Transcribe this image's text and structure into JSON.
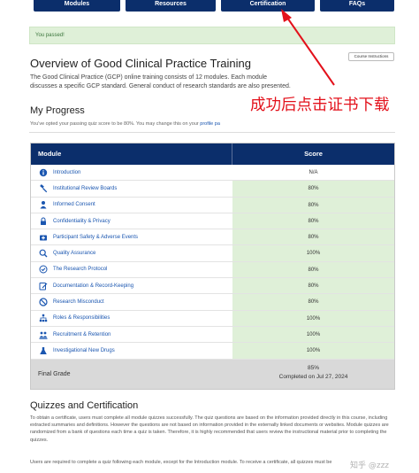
{
  "nav": {
    "tabs": [
      {
        "label": "Modules"
      },
      {
        "label": "Resources"
      },
      {
        "label": "Certification"
      },
      {
        "label": "FAQs"
      }
    ]
  },
  "alert": {
    "text": "You passed!"
  },
  "header": {
    "title": "Overview of Good Clinical Practice Training",
    "course_instructions_button": "Course Instructions",
    "intro": "The Good Clinical Practice (GCP) online training consists of 12 modules. Each module discusses a specific GCP standard. General conduct of research standards are also presented."
  },
  "progress": {
    "title": "My Progress",
    "passing_text": "You've opted your passing quiz score to be 80%. You may change this on your",
    "passing_link": "profile pa"
  },
  "table": {
    "headers": {
      "module": "Module",
      "score": "Score"
    },
    "rows": [
      {
        "icon": "info-icon",
        "module": "Introduction",
        "score": "N/A"
      },
      {
        "icon": "gavel-icon",
        "module": "Institutional Review Boards",
        "score": "80%"
      },
      {
        "icon": "person-icon",
        "module": "Informed Consent",
        "score": "80%"
      },
      {
        "icon": "lock-icon",
        "module": "Confidentiality & Privacy",
        "score": "80%"
      },
      {
        "icon": "first-aid-kit-icon",
        "module": "Participant Safety & Adverse Events",
        "score": "80%"
      },
      {
        "icon": "magnifier-icon",
        "module": "Quality Assurance",
        "score": "100%"
      },
      {
        "icon": "checkmark-circle-icon",
        "module": "The Research Protocol",
        "score": "80%"
      },
      {
        "icon": "edit-document-icon",
        "module": "Documentation & Record-Keeping",
        "score": "80%"
      },
      {
        "icon": "prohibited-icon",
        "module": "Research Misconduct",
        "score": "80%"
      },
      {
        "icon": "sitemap-icon",
        "module": "Roles & Responsibilities",
        "score": "100%"
      },
      {
        "icon": "people-group-icon",
        "module": "Recruitment & Retention",
        "score": "100%"
      },
      {
        "icon": "flask-icon",
        "module": "Investigational New Drugs",
        "score": "100%"
      }
    ],
    "final": {
      "label": "Final Grade",
      "score": "85%",
      "completed": "Completed on Jul 27, 2024"
    }
  },
  "quizzes": {
    "title": "Quizzes and Certification",
    "para1": "To obtain a certificate, users must complete all module quizzes successfully. The quiz questions are based on the information provided directly in this course, including extracted summaries and definitions. However the questions are not based on information provided in the externally linked documents or websites. Module quizzes are randomized from a bank of questions each time a quiz is taken. Therefore, it is highly recommended that users review the instructional material prior to completing the quizzes.",
    "para2": "Users are required to complete a quiz following each module, except for the Introduction module. To receive a certificate, all quizzes must be"
  },
  "annotation": {
    "text": "成功后点击证书下载",
    "color": "#e3111b"
  },
  "watermark": {
    "text": "知乎 @zzz"
  },
  "colors": {
    "nav": "#0b2e6b",
    "score_green": "#dff0d8",
    "link": "#1a56b0"
  }
}
